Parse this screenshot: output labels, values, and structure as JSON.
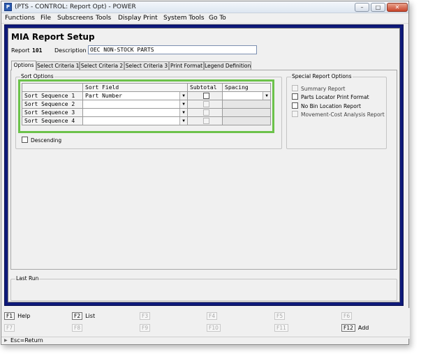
{
  "window": {
    "title": "(PTS - CONTROL: Report Opt) - POWER",
    "icon": "app-icon",
    "controls": [
      "minimize-icon",
      "maximize-icon",
      "close-icon"
    ]
  },
  "menu": [
    "Functions",
    "File",
    "Subscreens",
    "Tools",
    "Display",
    "Print",
    "System Tools",
    "Go To"
  ],
  "page": {
    "heading": "MIA Report Setup",
    "report_label": "Report",
    "report_value": "101",
    "description_label": "Description",
    "description_value": "OEC NON-STOCK PARTS"
  },
  "tabs": [
    "Options",
    "Select Criteria 1",
    "Select Criteria 2",
    "Select Criteria 3",
    "Print Format",
    "Legend Definition"
  ],
  "active_tab": "Options",
  "sort_options": {
    "title": "Sort Options",
    "columns": [
      "Sort Field",
      "Subtotal",
      "Spacing"
    ],
    "rows": [
      {
        "label": "Sort Sequence 1",
        "field": "Part Number",
        "subtotal": false,
        "spacing": ""
      },
      {
        "label": "Sort Sequence 2",
        "field": "",
        "subtotal": false,
        "spacing": ""
      },
      {
        "label": "Sort Sequence 3",
        "field": "",
        "subtotal": false,
        "spacing": ""
      },
      {
        "label": "Sort Sequence 4",
        "field": "",
        "subtotal": false,
        "spacing": ""
      }
    ],
    "descending_label": "Descending",
    "descending_checked": false
  },
  "special_options": {
    "title": "Special Report Options",
    "items": [
      {
        "label": "Summary Report",
        "enabled": false,
        "checked": false
      },
      {
        "label": "Parts Locator Print Format",
        "enabled": true,
        "checked": false
      },
      {
        "label": "No Bin Location Report",
        "enabled": true,
        "checked": false
      },
      {
        "label": "Movement-Cost Analysis Report",
        "enabled": false,
        "checked": false
      }
    ]
  },
  "last_run": {
    "title": "Last Run"
  },
  "function_keys": [
    {
      "key": "F1",
      "label": "Help",
      "enabled": true
    },
    {
      "key": "F2",
      "label": "List",
      "enabled": true
    },
    {
      "key": "F3",
      "label": "",
      "enabled": false
    },
    {
      "key": "F4",
      "label": "",
      "enabled": false
    },
    {
      "key": "F5",
      "label": "",
      "enabled": false
    },
    {
      "key": "F6",
      "label": "",
      "enabled": false
    },
    {
      "key": "F7",
      "label": "",
      "enabled": false
    },
    {
      "key": "F8",
      "label": "",
      "enabled": false
    },
    {
      "key": "F9",
      "label": "",
      "enabled": false
    },
    {
      "key": "F10",
      "label": "",
      "enabled": false
    },
    {
      "key": "F11",
      "label": "",
      "enabled": false
    },
    {
      "key": "F12",
      "label": "Add",
      "enabled": true
    }
  ],
  "status": {
    "text": "Esc=Return"
  },
  "colors": {
    "frame": "#0e1a7a",
    "highlight": "#6cc24a"
  }
}
